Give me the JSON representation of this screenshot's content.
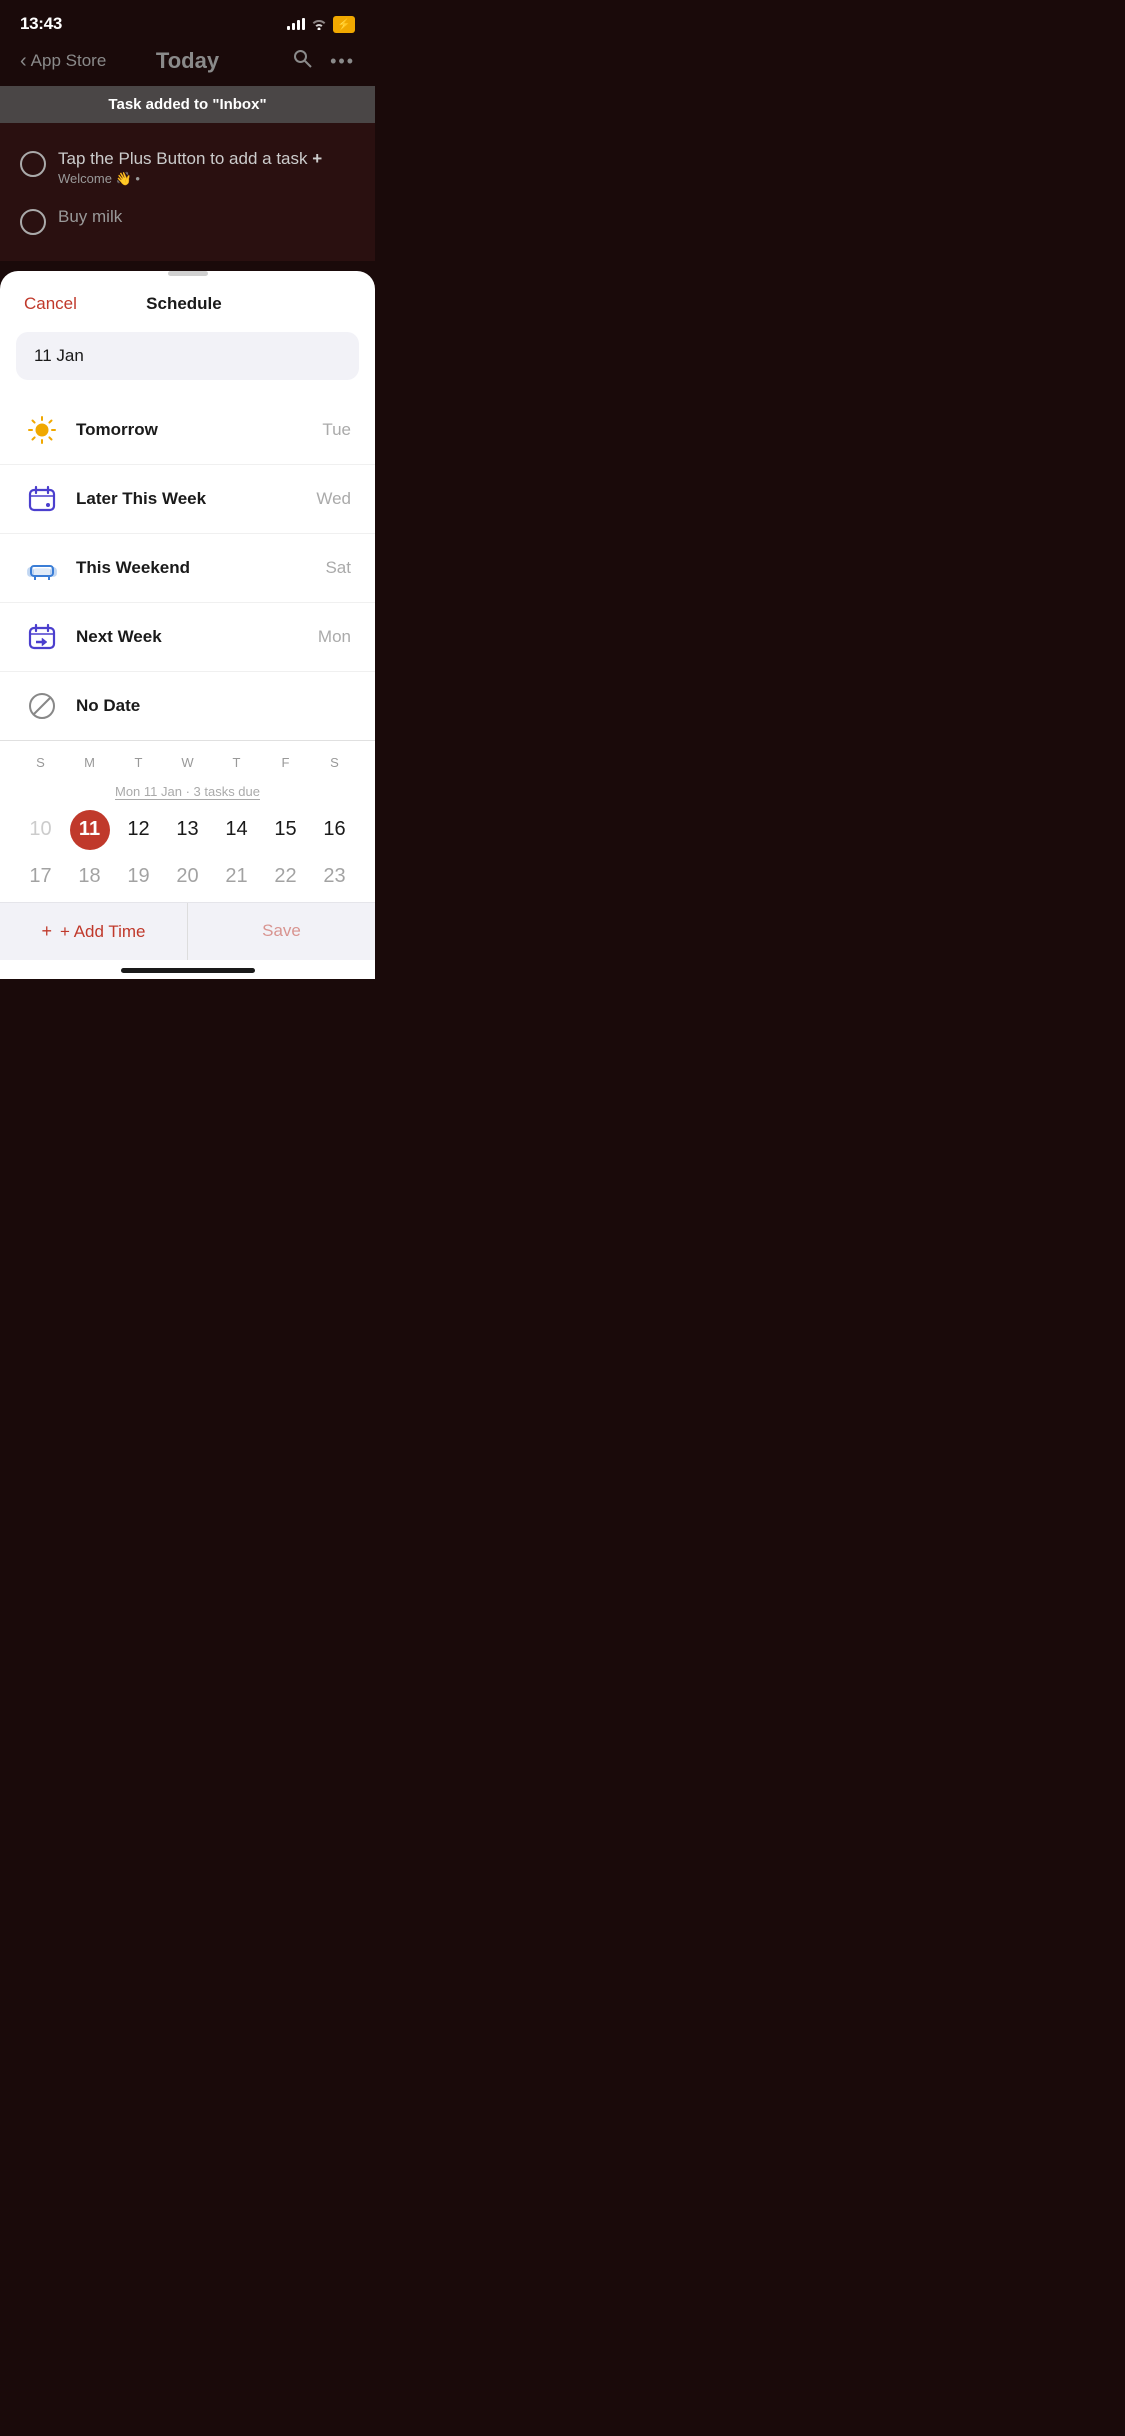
{
  "statusBar": {
    "time": "13:43",
    "backLabel": "App Store"
  },
  "nav": {
    "title": "Today",
    "backLabel": "App Store"
  },
  "notification": {
    "text": "Task added to \"Inbox\""
  },
  "tasks": [
    {
      "text": "Tap the Plus Button to add a task +",
      "subtext": "Welcome 👋 •",
      "faded": false
    },
    {
      "text": "Buy milk",
      "faded": true
    }
  ],
  "sheet": {
    "cancelLabel": "Cancel",
    "title": "Schedule",
    "dateInput": "11 Jan",
    "options": [
      {
        "id": "tomorrow",
        "label": "Tomorrow",
        "day": "Tue",
        "icon": "sun"
      },
      {
        "id": "later-week",
        "label": "Later This Week",
        "day": "Wed",
        "icon": "cal-later"
      },
      {
        "id": "weekend",
        "label": "This Weekend",
        "day": "Sat",
        "icon": "sofa"
      },
      {
        "id": "next-week",
        "label": "Next Week",
        "day": "Mon",
        "icon": "arrow-box"
      },
      {
        "id": "no-date",
        "label": "No Date",
        "day": "",
        "icon": "no-date"
      }
    ],
    "calendar": {
      "dowLabels": [
        "S",
        "M",
        "T",
        "W",
        "T",
        "F",
        "S"
      ],
      "subtext": "Mon 11 Jan · 3 tasks due",
      "weeks": [
        [
          {
            "day": "10",
            "faded": true
          },
          {
            "day": "11",
            "today": true
          },
          {
            "day": "12",
            "faded": false
          },
          {
            "day": "13",
            "faded": false
          },
          {
            "day": "14",
            "faded": false
          },
          {
            "day": "15",
            "faded": false
          },
          {
            "day": "16",
            "faded": false
          }
        ],
        [
          {
            "day": "17",
            "faded": false
          },
          {
            "day": "18",
            "faded": false
          },
          {
            "day": "19",
            "faded": false
          },
          {
            "day": "20",
            "faded": false
          },
          {
            "day": "21",
            "faded": false
          },
          {
            "day": "22",
            "faded": false
          },
          {
            "day": "23",
            "faded": false
          }
        ]
      ]
    },
    "addTimeLabel": "+ Add Time",
    "saveLabel": "Save"
  }
}
